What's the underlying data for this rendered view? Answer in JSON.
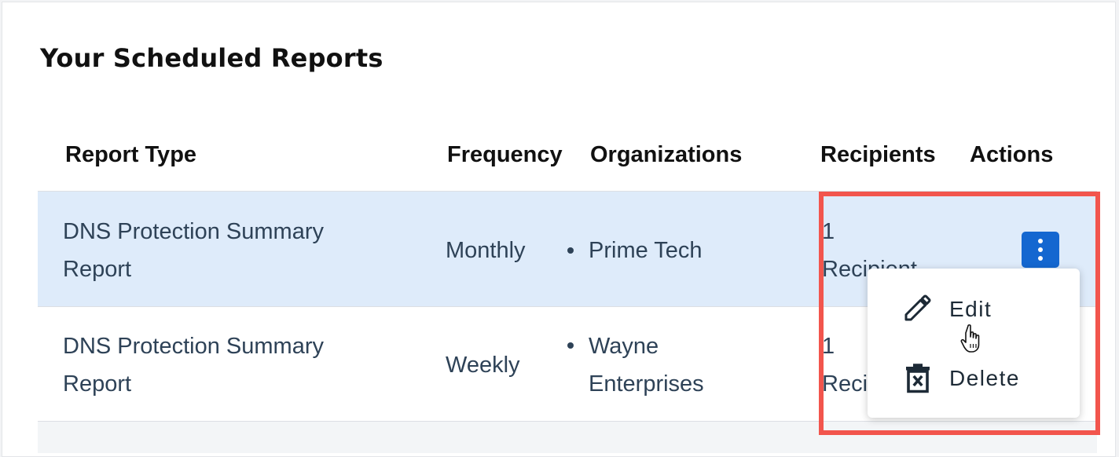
{
  "page": {
    "title": "Your Scheduled Reports"
  },
  "table": {
    "headers": {
      "report_type": "Report Type",
      "frequency": "Frequency",
      "organizations": "Organizations",
      "recipients": "Recipients",
      "actions": "Actions"
    },
    "rows": [
      {
        "report_line1": "DNS Protection Summary",
        "report_line2": "Report",
        "frequency": "Monthly",
        "org_line1": "Prime Tech",
        "org_line2": "",
        "recipients_line1": "1",
        "recipients_line2": "Recipient"
      },
      {
        "report_line1": "DNS Protection Summary",
        "report_line2": "Report",
        "frequency": "Weekly",
        "org_line1": "Wayne",
        "org_line2": "Enterprises",
        "recipients_line1": "1",
        "recipients_line2": "Recipient"
      }
    ]
  },
  "actions_menu": {
    "edit_label": "Edit",
    "delete_label": "Delete",
    "edit_icon": "pencil-icon",
    "delete_icon": "trash-icon",
    "kebab_icon": "kebab-icon"
  },
  "colors": {
    "accent": "#1467d0",
    "highlight": "#f2554d",
    "selected_row": "#deebfa",
    "text": "#2e4257"
  }
}
